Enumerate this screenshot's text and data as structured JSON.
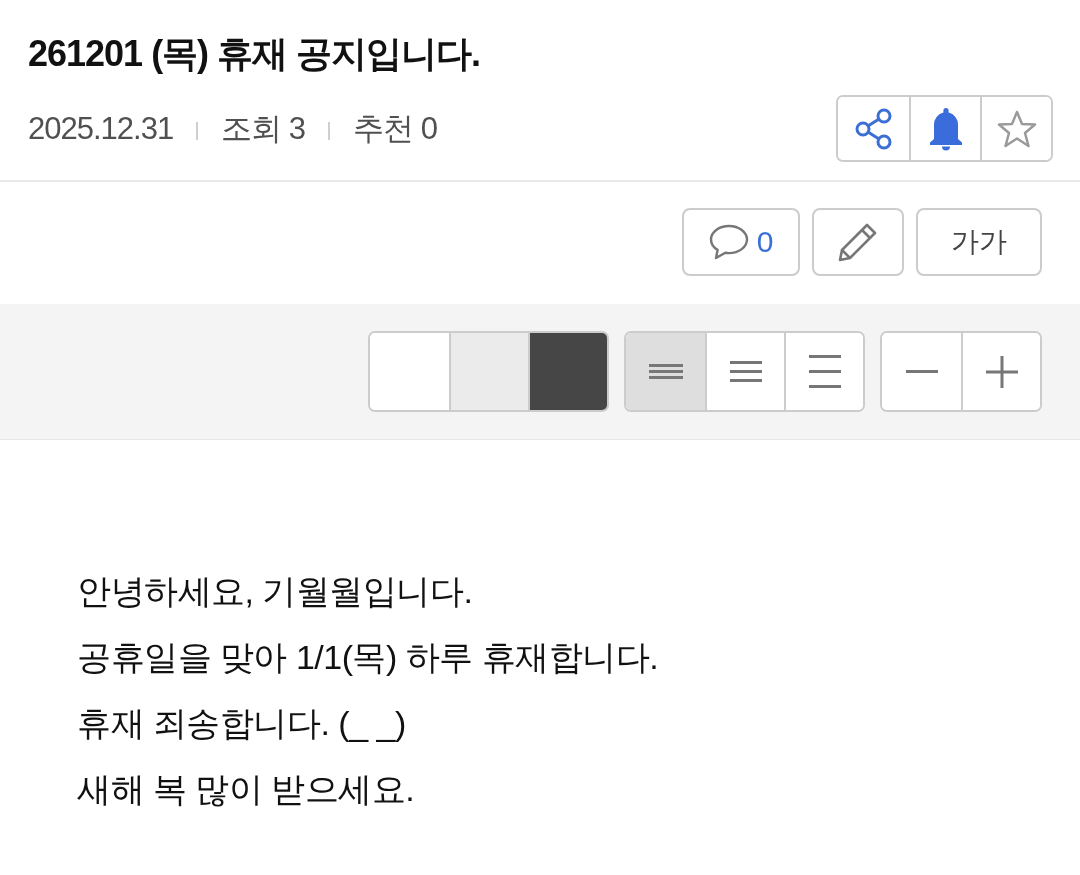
{
  "post": {
    "title": "261201 (목) 휴재 공지입니다.",
    "date": "2025.12.31",
    "views": "조회 3",
    "recommendations": "추천 0"
  },
  "post_actions": [
    {
      "kind": "share"
    },
    {
      "kind": "notify",
      "on": true
    },
    {
      "kind": "favorite",
      "on": false
    }
  ],
  "toolbar": [
    {
      "kind": "comments",
      "count": "0"
    },
    {
      "kind": "edit"
    },
    {
      "kind": "font",
      "label": "가가"
    }
  ],
  "reader_settings": {
    "themes": [
      {
        "color": "#ffffff"
      },
      {
        "color": "#ebebeb"
      },
      {
        "color": "#464646"
      }
    ],
    "line_spacing": [
      {
        "kind": "narrow",
        "selected": true
      },
      {
        "kind": "medium",
        "selected": false
      },
      {
        "kind": "wide",
        "selected": false
      }
    ],
    "font_size": [
      {
        "kind": "decrease"
      },
      {
        "kind": "increase"
      }
    ]
  },
  "body": {
    "lines": [
      "안녕하세요, 기월월입니다.",
      "공휴일을 맞아 1/1(목) 하루 휴재합니다.",
      "휴재 죄송합니다. (_ _)",
      "새해 복 많이 받으세요."
    ]
  }
}
